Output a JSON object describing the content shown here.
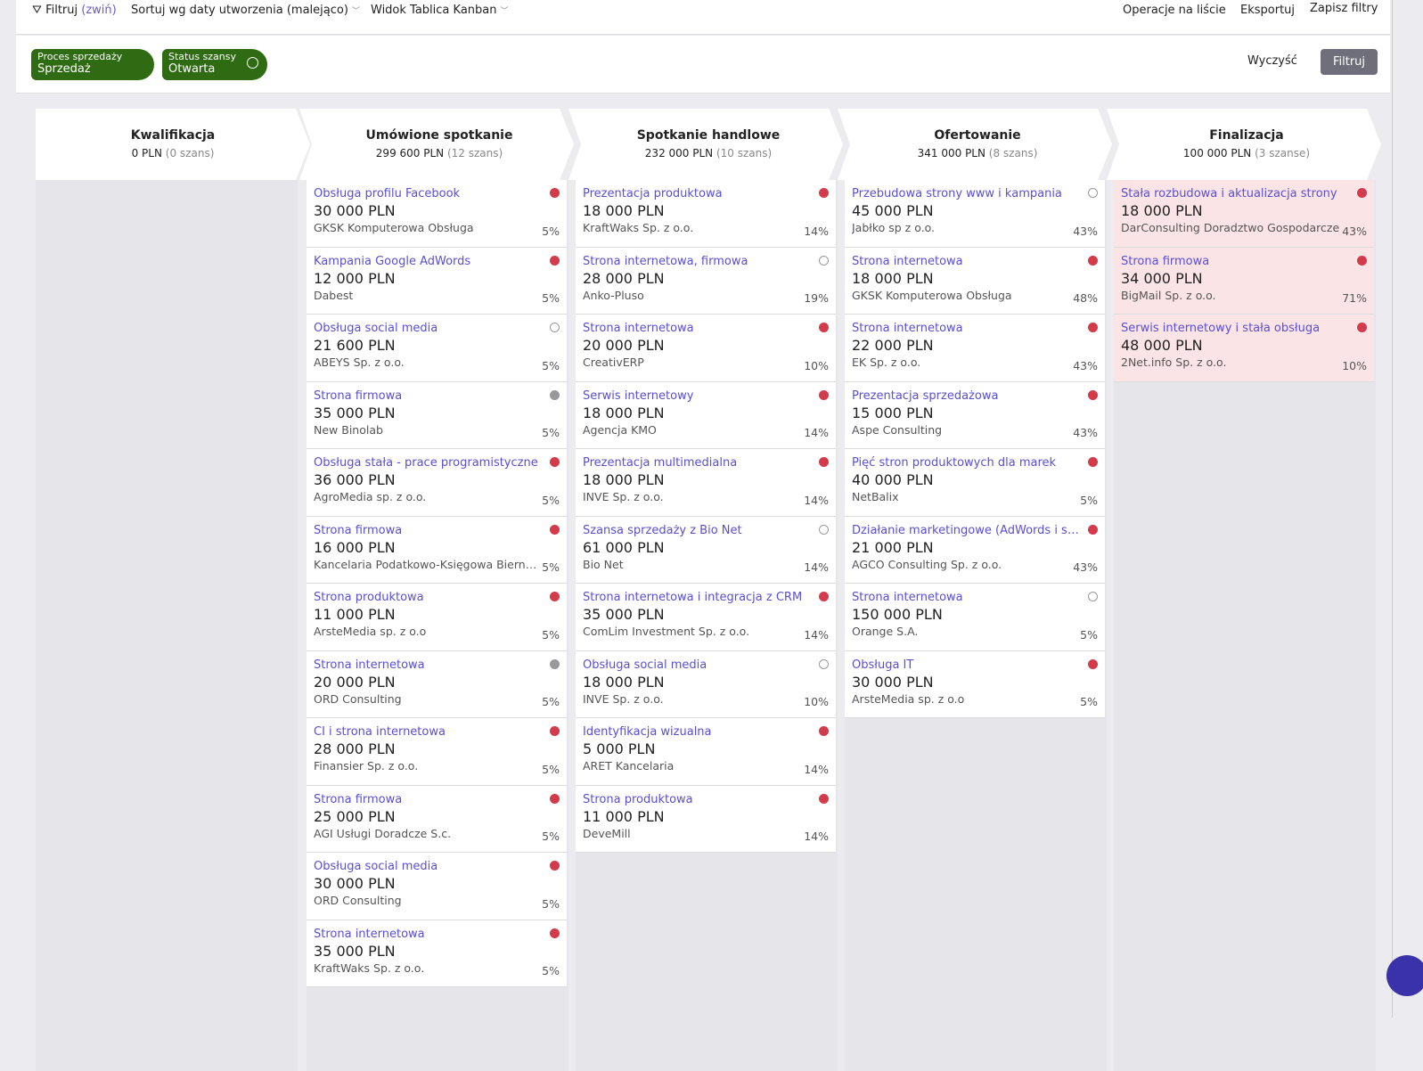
{
  "toolbar": {
    "filter": "Filtruj",
    "collapse": "(zwiń)",
    "sort": "Sortuj wg daty utworzenia (malejąco)",
    "view": "Widok Tablica Kanban",
    "list_ops": "Operacje na liście",
    "export": "Eksportuj",
    "save_filters": "Zapisz filtry"
  },
  "filters": {
    "chips": [
      {
        "label": "Proces sprzedaży",
        "value": "Sprzedaż"
      },
      {
        "label": "Status szansy",
        "value": "Otwarta",
        "icon": "lock-icon"
      }
    ],
    "clear": "Wyczyść",
    "apply": "Filtruj"
  },
  "colors": {
    "accent": "#5a4fcf",
    "chip": "#2f6b12",
    "red": "#d33a4a",
    "pink": "#fbe4e6"
  },
  "columns": [
    {
      "title": "Kwalifikacja",
      "sum": "0 PLN",
      "count": "(0 szans)",
      "cards": []
    },
    {
      "title": "Umówione spotkanie",
      "sum": "299 600 PLN",
      "count": "(12 szans)",
      "cards": [
        [
          "Obsługa profilu Facebook",
          "30 000 PLN",
          "GKSK Komputerowa Obsługa",
          "5%",
          "red"
        ],
        [
          "Kampania Google AdWords",
          "12 000 PLN",
          "Dabest",
          "5%",
          "red"
        ],
        [
          "Obsługa social media",
          "21 600 PLN",
          "ABEYS Sp. z o.o.",
          "5%",
          "empty"
        ],
        [
          "Strona firmowa",
          "35 000 PLN",
          "New Binolab",
          "5%",
          "gray"
        ],
        [
          "Obsługa stała - prace programistyczne",
          "36 000 PLN",
          "AgroMedia sp. z o.o.",
          "5%",
          "red"
        ],
        [
          "Strona firmowa",
          "16 000 PLN",
          "Kancelaria Podatkowo-Księgowa Bierna...",
          "5%",
          "red"
        ],
        [
          "Strona produktowa",
          "11 000 PLN",
          "ArsteMedia sp. z o.o",
          "5%",
          "red"
        ],
        [
          "Strona internetowa",
          "20 000 PLN",
          "ORD Consulting",
          "5%",
          "gray"
        ],
        [
          "CI i strona internetowa",
          "28 000 PLN",
          "Finansier Sp. z o.o.",
          "5%",
          "red"
        ],
        [
          "Strona firmowa",
          "25 000 PLN",
          "AGI Usługi Doradcze S.c.",
          "5%",
          "red"
        ],
        [
          "Obsługa social media",
          "30 000 PLN",
          "ORD Consulting",
          "5%",
          "red"
        ],
        [
          "Strona internetowa",
          "35 000 PLN",
          "KraftWaks Sp. z o.o.",
          "5%",
          "red"
        ]
      ]
    },
    {
      "title": "Spotkanie handlowe",
      "sum": "232 000 PLN",
      "count": "(10 szans)",
      "cards": [
        [
          "Prezentacja produktowa",
          "18 000 PLN",
          "KraftWaks Sp. z o.o.",
          "14%",
          "red"
        ],
        [
          "Strona internetowa, firmowa",
          "28 000 PLN",
          "Anko-Pluso",
          "19%",
          "empty"
        ],
        [
          "Strona internetowa",
          "20 000 PLN",
          "CreativERP",
          "10%",
          "red"
        ],
        [
          "Serwis internetowy",
          "18 000 PLN",
          "Agencja KMO",
          "14%",
          "red"
        ],
        [
          "Prezentacja multimedialna",
          "18 000 PLN",
          "INVE Sp. z o.o.",
          "14%",
          "red"
        ],
        [
          "Szansa sprzedaży z Bio Net",
          "61 000 PLN",
          "Bio Net",
          "14%",
          "empty"
        ],
        [
          "Strona internetowa i integracja z CRM",
          "35 000 PLN",
          "ComLim Investment Sp. z o.o.",
          "14%",
          "red"
        ],
        [
          "Obsługa social media",
          "18 000 PLN",
          "INVE Sp. z o.o.",
          "10%",
          "empty"
        ],
        [
          "Identyfikacja wizualna",
          "5 000 PLN",
          "ARET Kancelaria",
          "14%",
          "red"
        ],
        [
          "Strona produktowa",
          "11 000 PLN",
          "DeveMill",
          "14%",
          "red"
        ]
      ]
    },
    {
      "title": "Ofertowanie",
      "sum": "341 000 PLN",
      "count": "(8 szans)",
      "cards": [
        [
          "Przebudowa strony www i kampania",
          "45 000 PLN",
          "Jabłko sp z o.o.",
          "43%",
          "empty"
        ],
        [
          "Strona internetowa",
          "18 000 PLN",
          "GKSK Komputerowa Obsługa",
          "48%",
          "red"
        ],
        [
          "Strona internetowa",
          "22 000 PLN",
          "EK Sp. z o.o.",
          "43%",
          "red"
        ],
        [
          "Prezentacja sprzedażowa",
          "15 000 PLN",
          "Aspe Consulting",
          "43%",
          "red"
        ],
        [
          "Pięć stron produktowych dla marek",
          "40 000 PLN",
          "NetBalix",
          "5%",
          "red"
        ],
        [
          "Działanie marketingowe (AdWords i soci...",
          "21 000 PLN",
          "AGCO Consulting Sp. z o.o.",
          "43%",
          "red"
        ],
        [
          "Strona internetowa",
          "150 000 PLN",
          "Orange S.A.",
          "5%",
          "empty"
        ],
        [
          "Obsługa IT",
          "30 000 PLN",
          "ArsteMedia sp. z o.o",
          "5%",
          "red"
        ]
      ]
    },
    {
      "title": "Finalizacja",
      "sum": "100 000 PLN",
      "count": "(3 szanse)",
      "pink": true,
      "cards": [
        [
          "Stała rozbudowa i aktualizacja strony",
          "18 000 PLN",
          "DarConsulting Doradztwo Gospodarcze",
          "43%",
          "red"
        ],
        [
          "Strona firmowa",
          "34 000 PLN",
          "BigMail Sp. z o.o.",
          "71%",
          "red"
        ],
        [
          "Serwis internetowy i stała obsługa",
          "48 000 PLN",
          "2Net.info Sp. z o.o.",
          "10%",
          "red"
        ]
      ]
    }
  ]
}
